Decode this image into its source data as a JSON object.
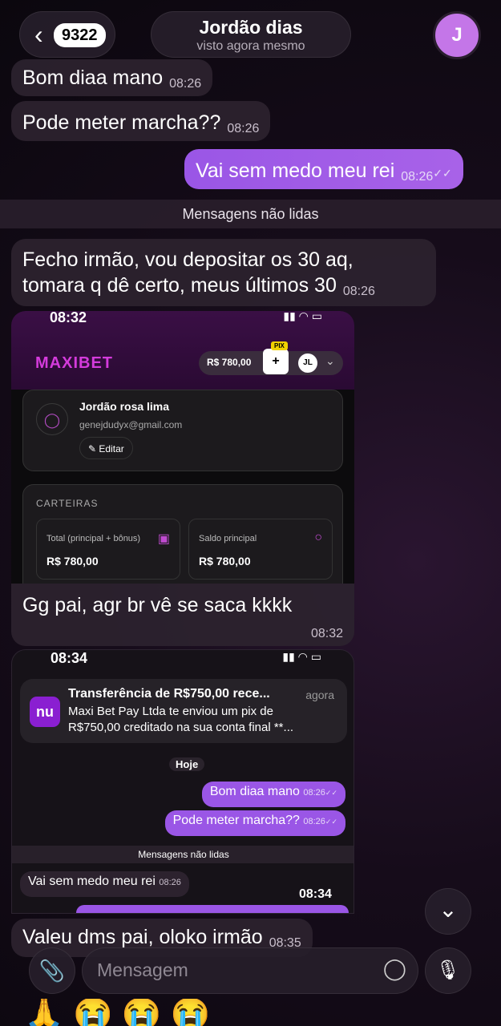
{
  "header": {
    "back_count": "9322",
    "contact_name": "Jordão dias",
    "status": "visto agora mesmo",
    "avatar_initial": "J"
  },
  "messages": [
    {
      "text": "Bom diaa mano",
      "time": "08:26"
    },
    {
      "text": "Pode meter marcha??",
      "time": "08:26"
    },
    {
      "text": "Vai sem medo meu rei",
      "time": "08:26"
    },
    {
      "text": "Fecho irmão, vou depositar os 30 aq,",
      "text2": "tomara q dê certo, meus últimos 30",
      "time": "08:26"
    },
    {
      "text": "Gg pai, agr br vê se saca kkkk",
      "time": "08:32"
    },
    {
      "text": "Valeu dms pai, oloko irmão",
      "time": "08:35"
    }
  ],
  "unread_banner": "Mensagens não lidas",
  "screenshot1": {
    "status_time": "08:32",
    "brand": "MAXIBET",
    "balance": "R$ 780,00",
    "pix_badge": "PIX",
    "initials": "JL",
    "user_name": "Jordão rosa lima",
    "email": "genejdudyx@gmail.com",
    "edit": "Editar",
    "wallets_title": "CARTEIRAS",
    "wallet1_label": "Total (principal + bônus)",
    "wallet1_value": "R$ 780,00",
    "wallet2_label": "Saldo principal",
    "wallet2_value": "R$ 780,00"
  },
  "screenshot2": {
    "status_time": "08:34",
    "notif_app": "nu",
    "notif_title": "Transferência de R$750,00 rece...",
    "notif_when": "agora",
    "notif_body1": "Maxi Bet Pay Ltda te enviou um pix de",
    "notif_body2": "R$750,00 creditado na sua conta final **...",
    "today": "Hoje",
    "m1": "Bom diaa mano",
    "m1_time": "08:26",
    "m2": "Pode meter marcha??",
    "m2_time": "08:26",
    "banner": "Mensagens não lidas",
    "m3": "Vai sem medo meu rei",
    "m3_time": "08:26",
    "overlay_time": "08:34"
  },
  "composer": {
    "placeholder": "Mensagem"
  }
}
